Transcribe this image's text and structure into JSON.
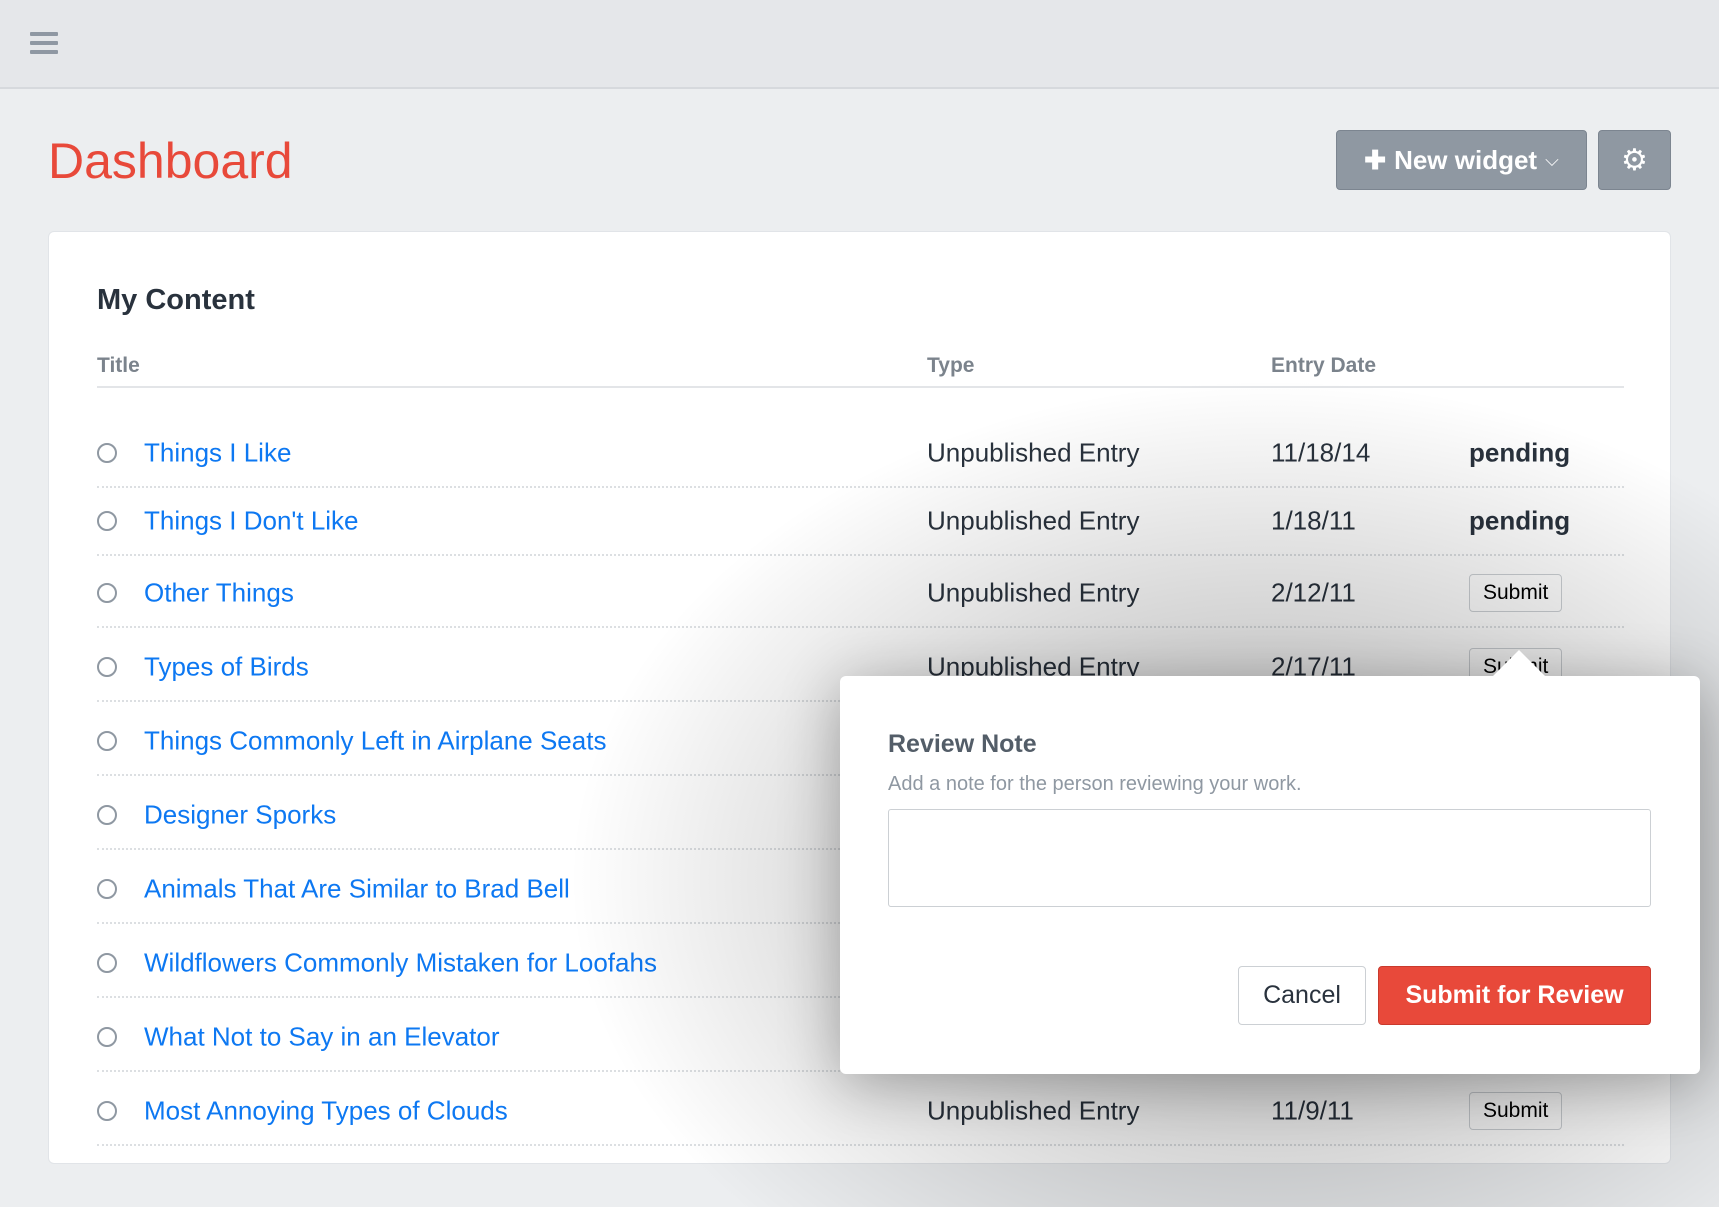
{
  "header": {
    "menu_icon": "hamburger-icon"
  },
  "page": {
    "title": "Dashboard",
    "new_widget_label": "New widget",
    "plus_icon": "plus-icon",
    "chevron_icon": "chevron-down-icon",
    "settings_icon": "gear-icon"
  },
  "card": {
    "title": "My Content",
    "columns": [
      "Title",
      "Type",
      "Entry Date"
    ],
    "rows": [
      {
        "title": "Things I Like",
        "type": "Unpublished Entry",
        "date": "11/18/14",
        "status": "pending"
      },
      {
        "title": "Things I Don't Like",
        "type": "Unpublished Entry",
        "date": "1/18/11",
        "status": "pending"
      },
      {
        "title": "Other Things",
        "type": "Unpublished Entry",
        "date": "2/12/11",
        "status": "Submit"
      },
      {
        "title": "Types of Birds",
        "type": "Unpublished Entry",
        "date": "2/17/11",
        "status": "Submit"
      },
      {
        "title": "Things Commonly Left in Airplane Seats"
      },
      {
        "title": "Designer Sporks"
      },
      {
        "title": "Animals That Are Similar to Brad Bell"
      },
      {
        "title": "Wildflowers Commonly Mistaken for Loofahs"
      },
      {
        "title": "What Not to Say in an Elevator"
      },
      {
        "title": "Most Annoying Types of Clouds",
        "type": "Unpublished Entry",
        "date": "11/9/11",
        "status": "Submit"
      }
    ]
  },
  "popover": {
    "title": "Review Note",
    "hint": "Add a note for the person reviewing your work.",
    "note_value": "",
    "cancel_label": "Cancel",
    "submit_label": "Submit for Review"
  },
  "colors": {
    "accent": "#e8493a",
    "link": "#0d78f2",
    "button_gray": "#8f98a2"
  }
}
